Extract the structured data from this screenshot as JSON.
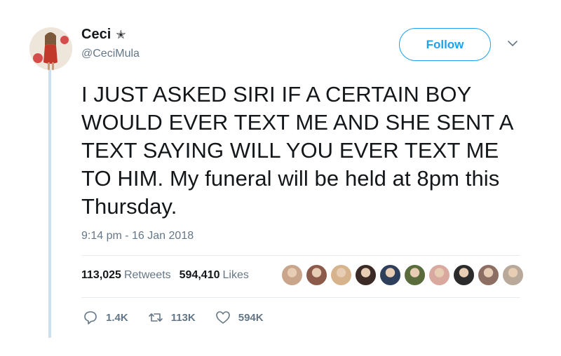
{
  "user": {
    "display_name": "Ceci",
    "badge_icon": "star-icon",
    "badge_glyph": "✭",
    "handle": "@CeciMula"
  },
  "follow_label": "Follow",
  "tweet": {
    "text": "I JUST ASKED SIRI IF A CERTAIN BOY WOULD EVER TEXT ME AND SHE SENT A TEXT SAYING WILL YOU EVER TEXT ME TO HIM. My funeral will be held at 8pm this Thursday.",
    "timestamp": "9:14 pm - 16 Jan 2018"
  },
  "stats": {
    "retweets_count": "113,025",
    "retweets_label": "Retweets",
    "likes_count": "594,410",
    "likes_label": "Likes"
  },
  "likers": [
    "#c9a58c",
    "#8b5a4a",
    "#d6b38a",
    "#3b2a25",
    "#2e3f5c",
    "#5a6b3c",
    "#d9a9a0",
    "#2b2b2b",
    "#8d6e63",
    "#b8a99a"
  ],
  "actions": {
    "replies": "1.4K",
    "retweets": "113K",
    "likes": "594K"
  },
  "colors": {
    "accent": "#1da1f2",
    "muted": "#657786",
    "thread_line": "#cde0ef"
  }
}
